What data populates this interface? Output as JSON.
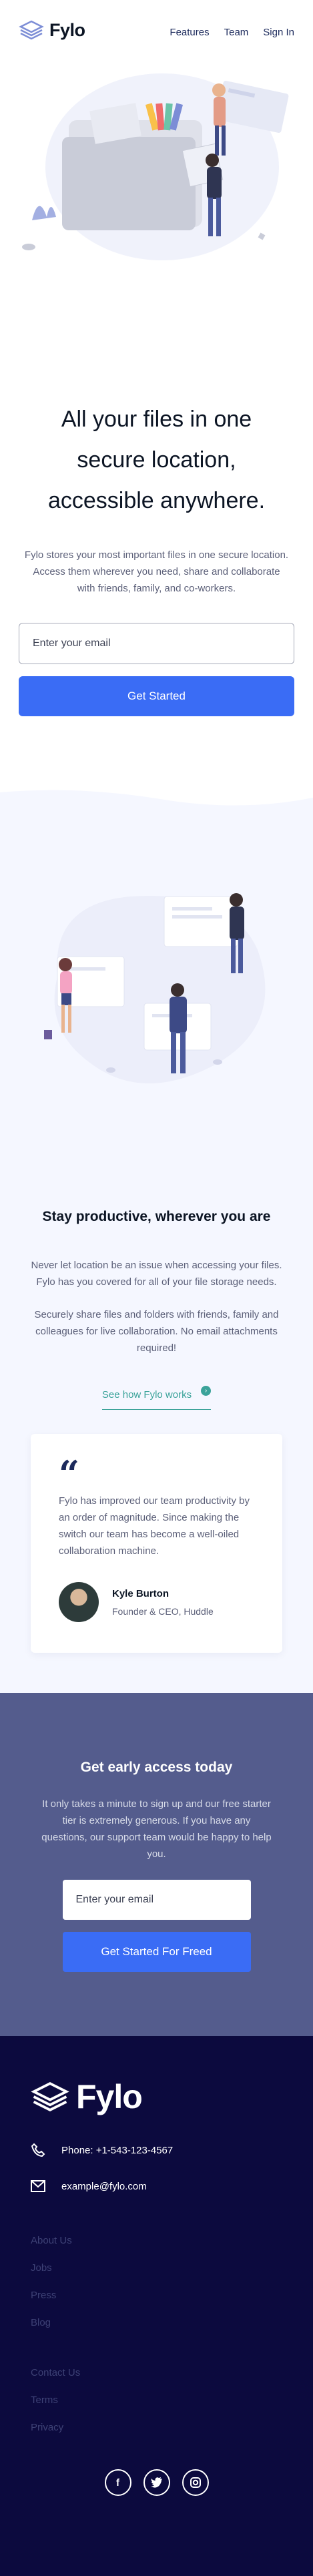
{
  "header": {
    "brand": "Fylo",
    "nav": [
      "Features",
      "Team",
      "Sign In"
    ]
  },
  "hero": {
    "title": "All your files in one secure location, accessible anywhere.",
    "description": "Fylo stores your most important files in one secure location. Access them wherever you need, share and collaborate with friends, family, and co-workers.",
    "email_placeholder": "Enter your email",
    "cta": "Get Started"
  },
  "productive": {
    "title": "Stay productive, wherever you are",
    "paragraph1": "Never let location be an issue when accessing your files. Fylo has you covered for all of your file storage needs.",
    "paragraph2": "Securely share files and folders with friends, family and colleagues for live collaboration. No email attachments required!",
    "link": "See how Fylo works",
    "testimonial": {
      "quote": "Fylo has improved our team productivity by an order of magnitude. Since making the switch our team has become a well-oiled collaboration machine.",
      "name": "Kyle Burton",
      "role": "Founder & CEO, Huddle"
    }
  },
  "early": {
    "title": "Get early access today",
    "description": "It only takes a minute to sign up and our free starter tier is extremely generous. If you have any questions, our support team would be happy to help you.",
    "email_placeholder": "Enter your email",
    "cta": "Get Started For Freed"
  },
  "footer": {
    "brand": "Fylo",
    "phone": "Phone: +1-543-123-4567",
    "email": "example@fylo.com",
    "links1": [
      "About Us",
      "Jobs",
      "Press",
      "Blog"
    ],
    "links2": [
      "Contact Us",
      "Terms",
      "Privacy"
    ],
    "socials": [
      "facebook-icon",
      "twitter-icon",
      "instagram-icon"
    ]
  },
  "colors": {
    "primary": "#3a6cf5",
    "accent_teal": "#3ba39a",
    "early_bg": "#545c8d",
    "footer_bg": "#0c0a3e",
    "section_bg": "#f5f7ff"
  }
}
